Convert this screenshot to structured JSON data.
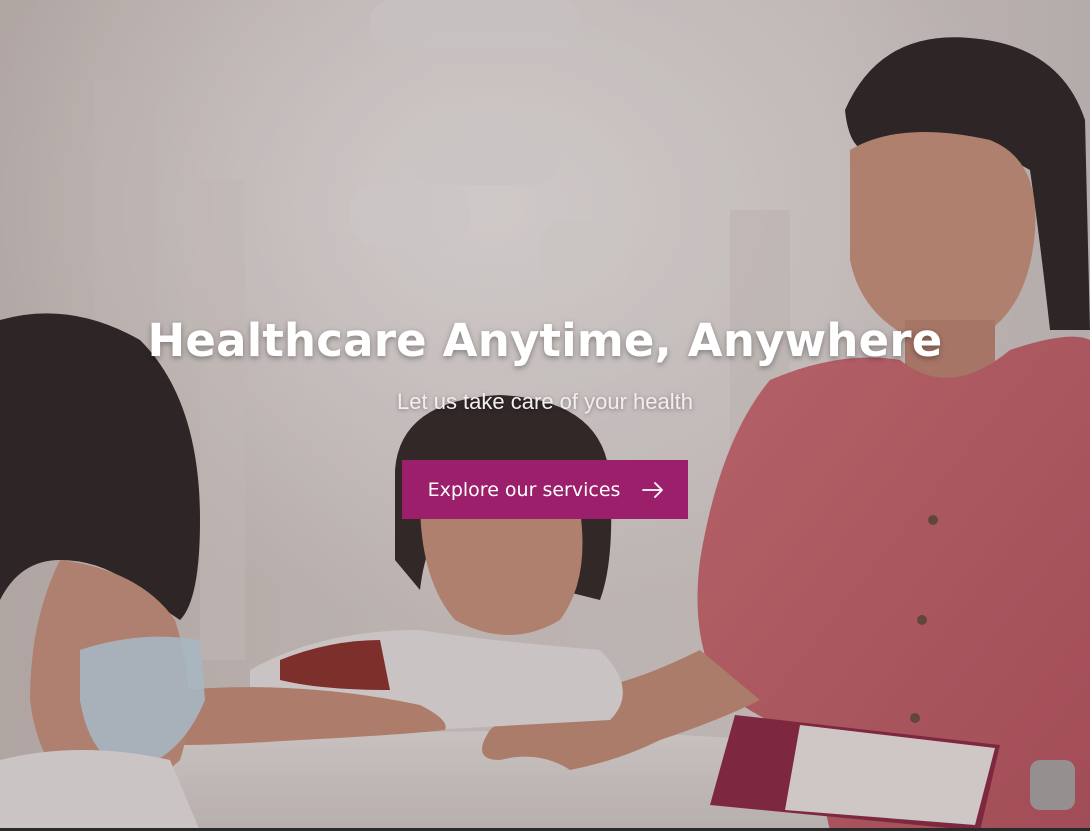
{
  "hero": {
    "title": "Healthcare Anytime, Anywhere",
    "subtitle": "Let us take care of your health",
    "cta_label": "Explore our services",
    "cta_icon": "arrow-right-icon"
  },
  "colors": {
    "cta_background": "#9c1f6b",
    "text": "#ffffff"
  }
}
